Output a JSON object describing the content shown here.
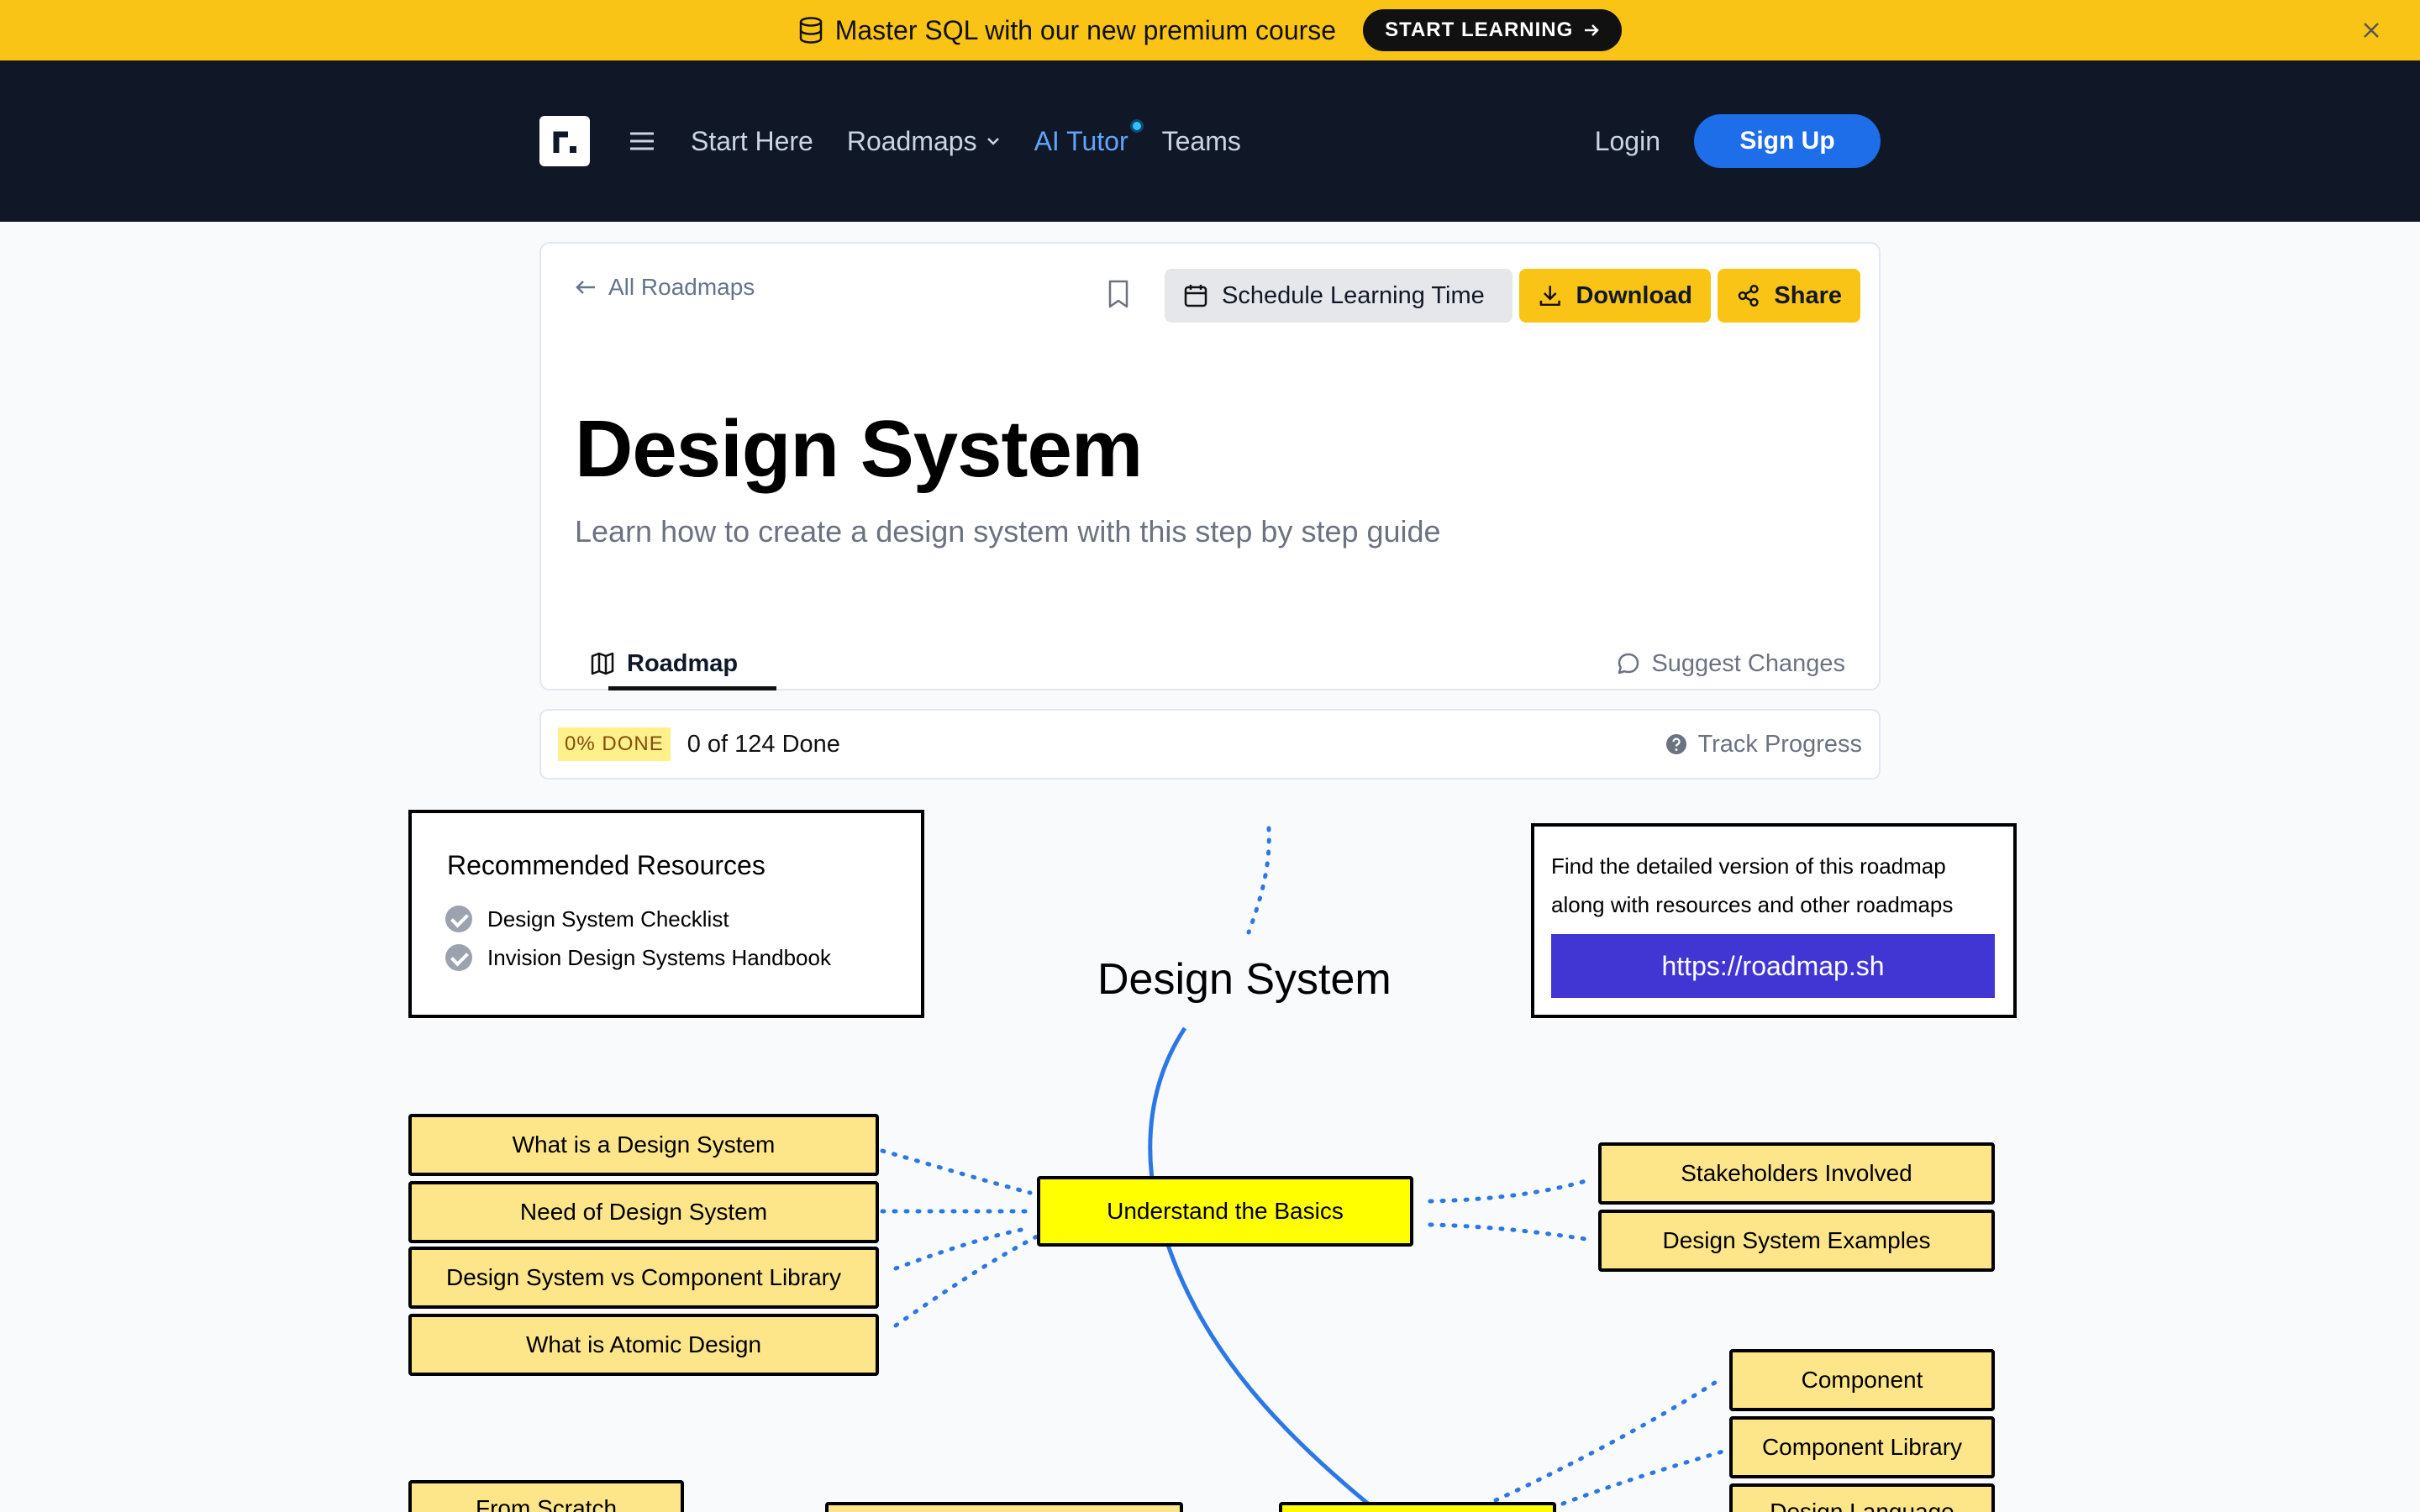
{
  "promo": {
    "text": "Master SQL with our new premium course",
    "cta": "START LEARNING"
  },
  "nav": {
    "links": [
      "Start Here",
      "Roadmaps",
      "AI Tutor",
      "Teams"
    ],
    "login": "Login",
    "signup": "Sign Up"
  },
  "header": {
    "back": "All Roadmaps",
    "schedule": "Schedule Learning Time",
    "download": "Download",
    "share": "Share",
    "title": "Design System",
    "subtitle": "Learn how to create a design system with this step by step guide",
    "tab": "Roadmap",
    "suggest": "Suggest Changes"
  },
  "progress": {
    "badge": "0% DONE",
    "count": "0 of 124 Done",
    "track": "Track Progress"
  },
  "roadmap": {
    "resources_title": "Recommended Resources",
    "resources": [
      "Design System Checklist",
      "Invision Design Systems Handbook"
    ],
    "detail_line1": "Find the detailed version of this roadmap",
    "detail_line2": "along with resources and other roadmaps",
    "detail_link": "https://roadmap.sh",
    "title": "Design System",
    "main_node": "Understand the Basics",
    "left_nodes": [
      "What is a Design System",
      "Need of Design System",
      "Design System vs Component Library",
      "What is Atomic Design"
    ],
    "right_nodes": [
      "Stakeholders Involved",
      "Design System Examples"
    ],
    "right_lower_nodes": [
      "Component",
      "Component Library",
      "Design Language"
    ],
    "bottom_left_node": "From Scratch"
  },
  "colors": {
    "promo": "#fac416",
    "nav_bg": "#101827",
    "accent_blue": "#1d6ee8",
    "node_fill": "#fde68a",
    "main_node_fill": "#ffff00",
    "link_button": "#4136d4",
    "connector": "#2b78e4"
  }
}
